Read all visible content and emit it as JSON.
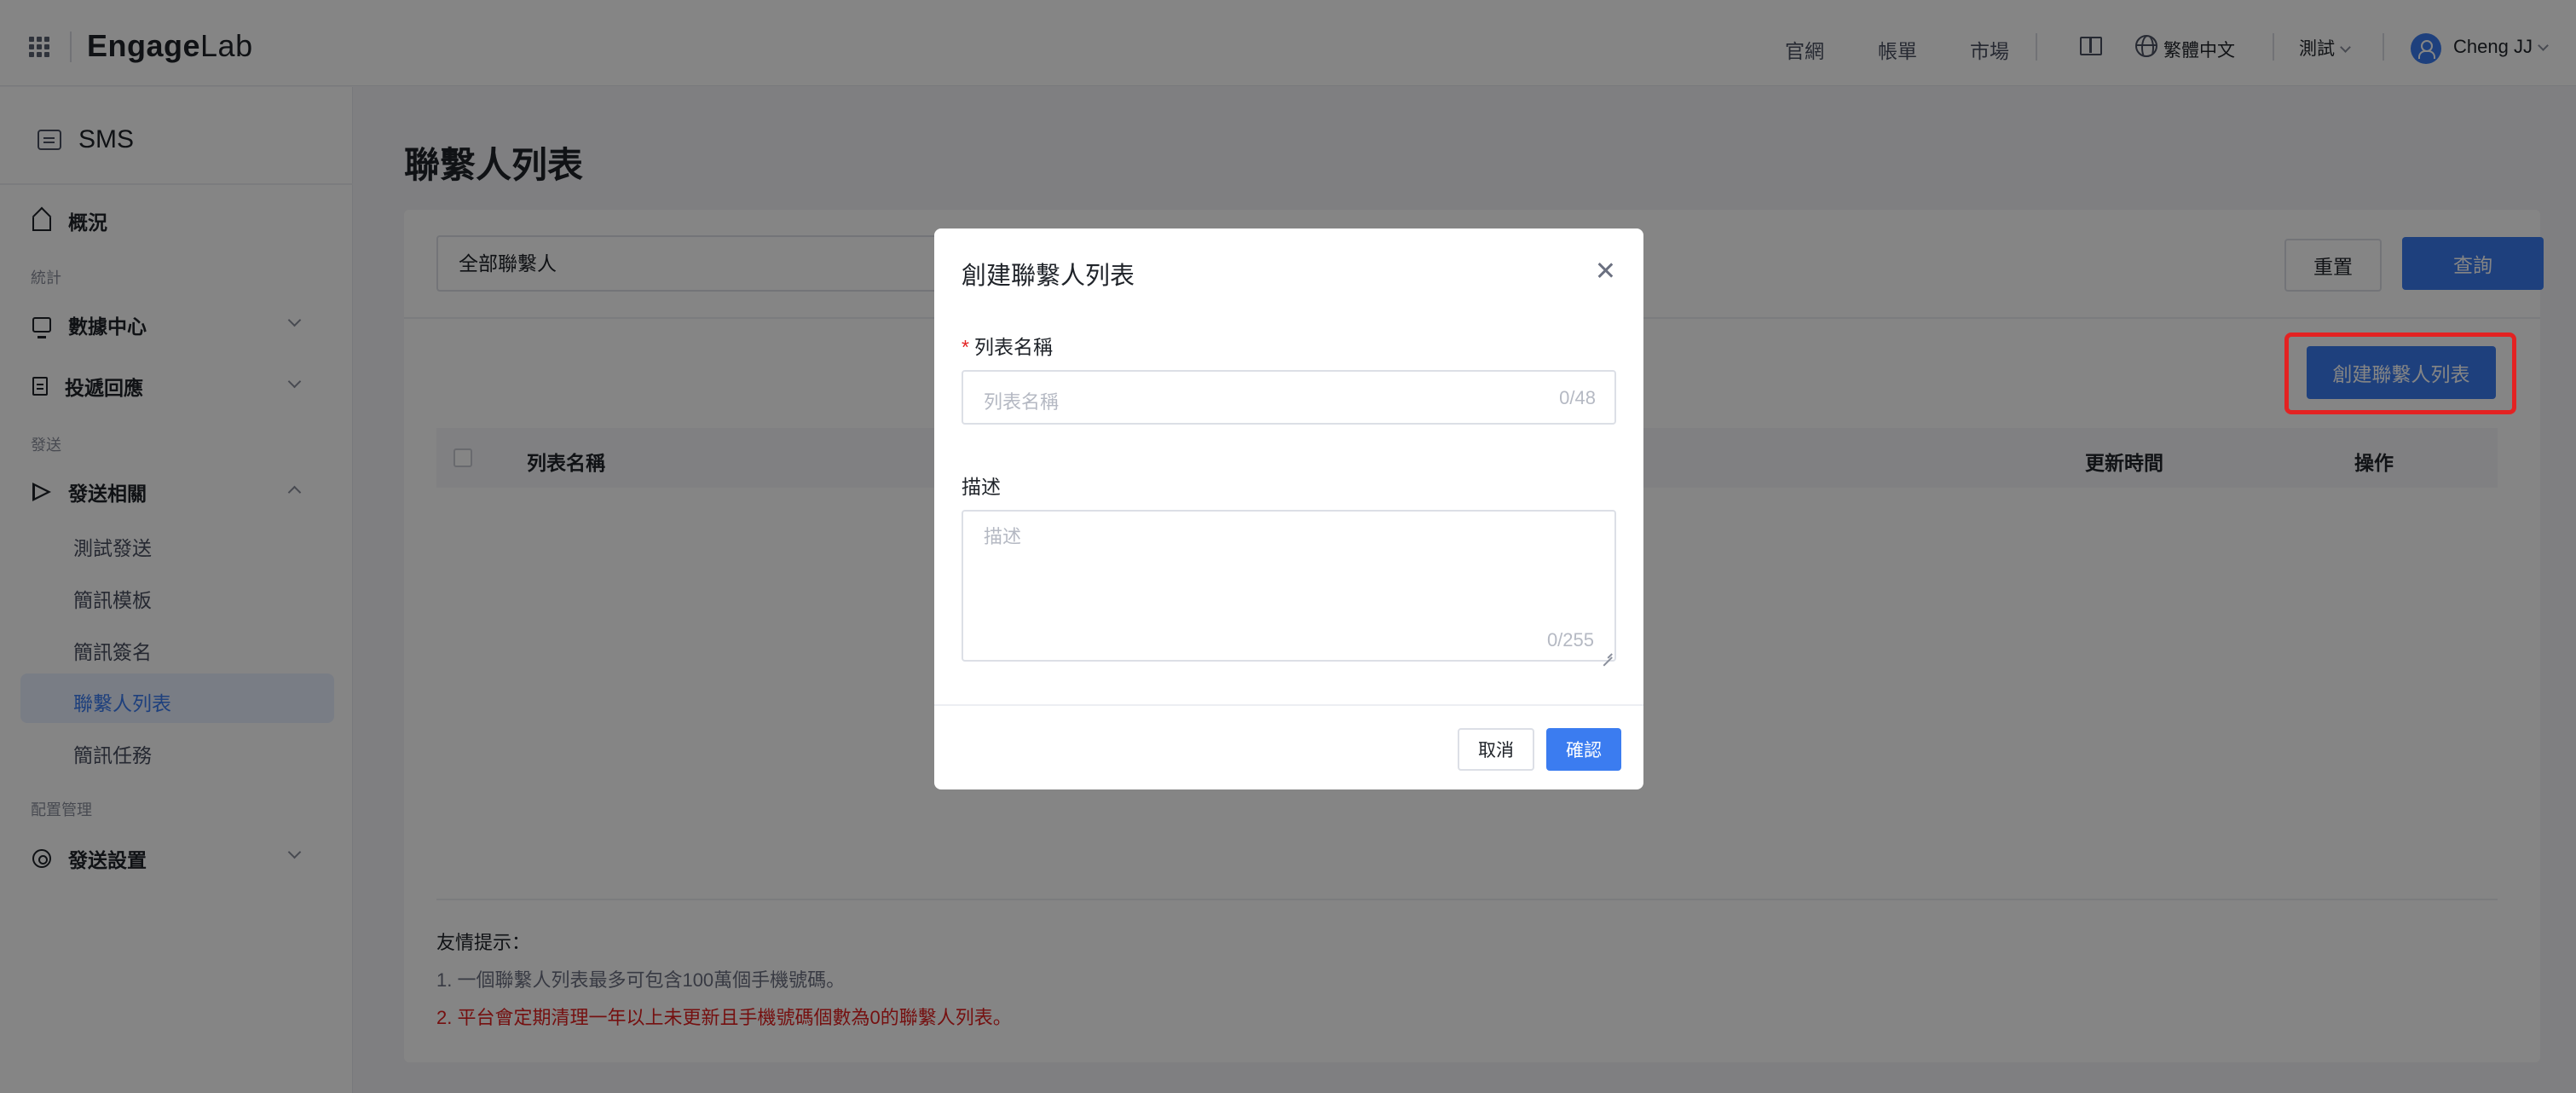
{
  "header": {
    "logo_main": "Engage",
    "logo_lab": "Lab",
    "nav": [
      "官網",
      "帳單",
      "市場"
    ],
    "language": "繁體中文",
    "workspace": "測試",
    "user_name": "Cheng JJ"
  },
  "sidebar": {
    "product": "SMS",
    "overview": "概況",
    "group_stats": "統計",
    "data_center": "數據中心",
    "delivery_response": "投遞回應",
    "group_send": "發送",
    "send_related": "發送相關",
    "sub_items": [
      "測試發送",
      "簡訊模板",
      "簡訊簽名",
      "聯繫人列表",
      "簡訊任務"
    ],
    "active_item": "聯繫人列表",
    "group_config": "配置管理",
    "send_settings": "發送設置"
  },
  "main": {
    "title": "聯繫人列表",
    "filter_value": "全部聯繫人",
    "reset_label": "重置",
    "query_label": "查詢",
    "create_label": "創建聯繫人列表",
    "columns": [
      "列表名稱",
      "更新時間",
      "操作"
    ],
    "tips_title": "友情提示：",
    "tip1": "1. 一個聯繫人列表最多可包含100萬個手機號碼。",
    "tip2": "2. 平台會定期清理一年以上未更新且手機號碼個數為0的聯繫人列表。"
  },
  "modal": {
    "title": "創建聯繫人列表",
    "name_label": "列表名稱",
    "name_required_mark": "*",
    "name_placeholder": "列表名稱",
    "name_count": "0/48",
    "desc_label": "描述",
    "desc_placeholder": "描述",
    "desc_count": "0/255",
    "cancel_label": "取消",
    "confirm_label": "確認"
  },
  "colors": {
    "primary": "#3b7cf0",
    "highlight": "#e32222",
    "warning_text": "#e02020"
  },
  "icons": [
    "apps-grid-icon",
    "book-icon",
    "globe-icon",
    "user-avatar-icon",
    "sms-icon",
    "home-icon",
    "monitor-icon",
    "document-icon",
    "send-icon",
    "settings-icon",
    "close-icon"
  ]
}
